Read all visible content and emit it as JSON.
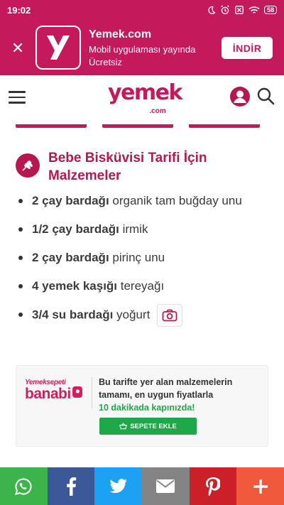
{
  "status_bar": {
    "time": "19:02",
    "battery": "58",
    "icons": [
      "moon-icon",
      "alarm-icon",
      "battery-saver-icon",
      "wifi-icon",
      "battery-icon"
    ]
  },
  "app_banner": {
    "title": "Yemek.com",
    "subtitle": "Mobil uygulaması yayında Ücretsiz",
    "install_label": "İNDİR",
    "close_icon": "close-icon",
    "logo_letter": "y"
  },
  "header": {
    "logo_text": "yemek",
    "logo_sub": ".com",
    "icons": [
      "menu-icon",
      "user-icon",
      "search-icon"
    ]
  },
  "ingredients": {
    "title": "Bebe Bisküvisi Tarifi İçin Malzemeler",
    "items": [
      {
        "qty": "2 çay bardağı",
        "name": " organik tam buğday unu"
      },
      {
        "qty": "1/2 çay bardağı",
        "name": " irmik"
      },
      {
        "qty": "2 çay bardağı",
        "name": " pirinç unu"
      },
      {
        "qty": "4 yemek kaşığı",
        "name": " tereyağı"
      },
      {
        "qty": "3/4 su bardağı",
        "name": " yoğurt"
      }
    ]
  },
  "promo": {
    "brand_top": "Yemeksepeti",
    "brand_main": "banabi",
    "line1": "Bu tarifte yer alan malzemelerin tamamı, en uygun fiyatlarla",
    "line2": "10 dakikada kapınızda!",
    "button": "SEPETE EKLE"
  },
  "share_bar": {
    "buttons": [
      {
        "name": "whatsapp",
        "color": "#3db449"
      },
      {
        "name": "facebook",
        "color": "#3b5998"
      },
      {
        "name": "twitter",
        "color": "#1da1f2"
      },
      {
        "name": "email",
        "color": "#848484"
      },
      {
        "name": "pinterest",
        "color": "#cb2027"
      },
      {
        "name": "more",
        "color": "#f1593c"
      }
    ]
  },
  "colors": {
    "brand": "#c4195b",
    "accent_green": "#1ea84a"
  }
}
